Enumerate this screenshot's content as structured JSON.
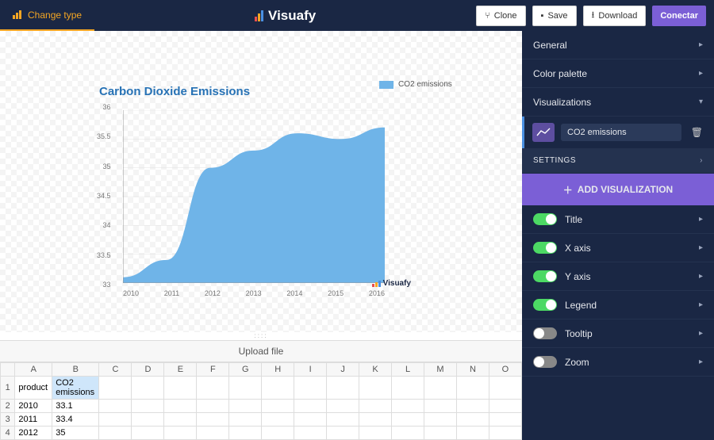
{
  "topbar": {
    "change_type": "Change type",
    "brand": "Visuafy",
    "clone": "Clone",
    "save": "Save",
    "download": "Download",
    "connect": "Conectar"
  },
  "chart_data": {
    "type": "area",
    "title": "Carbon Dioxide Emissions",
    "legend": "CO2 emissions",
    "categories": [
      "2010",
      "2011",
      "2012",
      "2013",
      "2014",
      "2015",
      "2016"
    ],
    "values": [
      33.1,
      33.4,
      35,
      35.3,
      35.6,
      35.5,
      35.7
    ],
    "ylim": [
      33,
      36
    ],
    "yticks": [
      36,
      35.5,
      35,
      34.5,
      34,
      33.5,
      33
    ],
    "watermark": "Visuafy"
  },
  "upload": {
    "label": "Upload file"
  },
  "sheet": {
    "cols": [
      "A",
      "B",
      "C",
      "D",
      "E",
      "F",
      "G",
      "H",
      "I",
      "J",
      "K",
      "L",
      "M",
      "N",
      "O"
    ],
    "rows": [
      {
        "n": "1",
        "cells": [
          "product",
          "CO2 emissions"
        ]
      },
      {
        "n": "2",
        "cells": [
          "2010",
          "33.1"
        ]
      },
      {
        "n": "3",
        "cells": [
          "2011",
          "33.4"
        ]
      },
      {
        "n": "4",
        "cells": [
          "2012",
          "35"
        ]
      }
    ],
    "selected": {
      "r": 0,
      "c": 1
    }
  },
  "side": {
    "general": "General",
    "palette": "Color palette",
    "visualizations": "Visualizations",
    "viz_name": "CO2 emissions",
    "settings": "SETTINGS",
    "add": "ADD VISUALIZATION",
    "toggles": [
      {
        "label": "Title",
        "on": true
      },
      {
        "label": "X axis",
        "on": true
      },
      {
        "label": "Y axis",
        "on": true
      },
      {
        "label": "Legend",
        "on": true
      },
      {
        "label": "Tooltip",
        "on": false
      },
      {
        "label": "Zoom",
        "on": false
      }
    ]
  }
}
